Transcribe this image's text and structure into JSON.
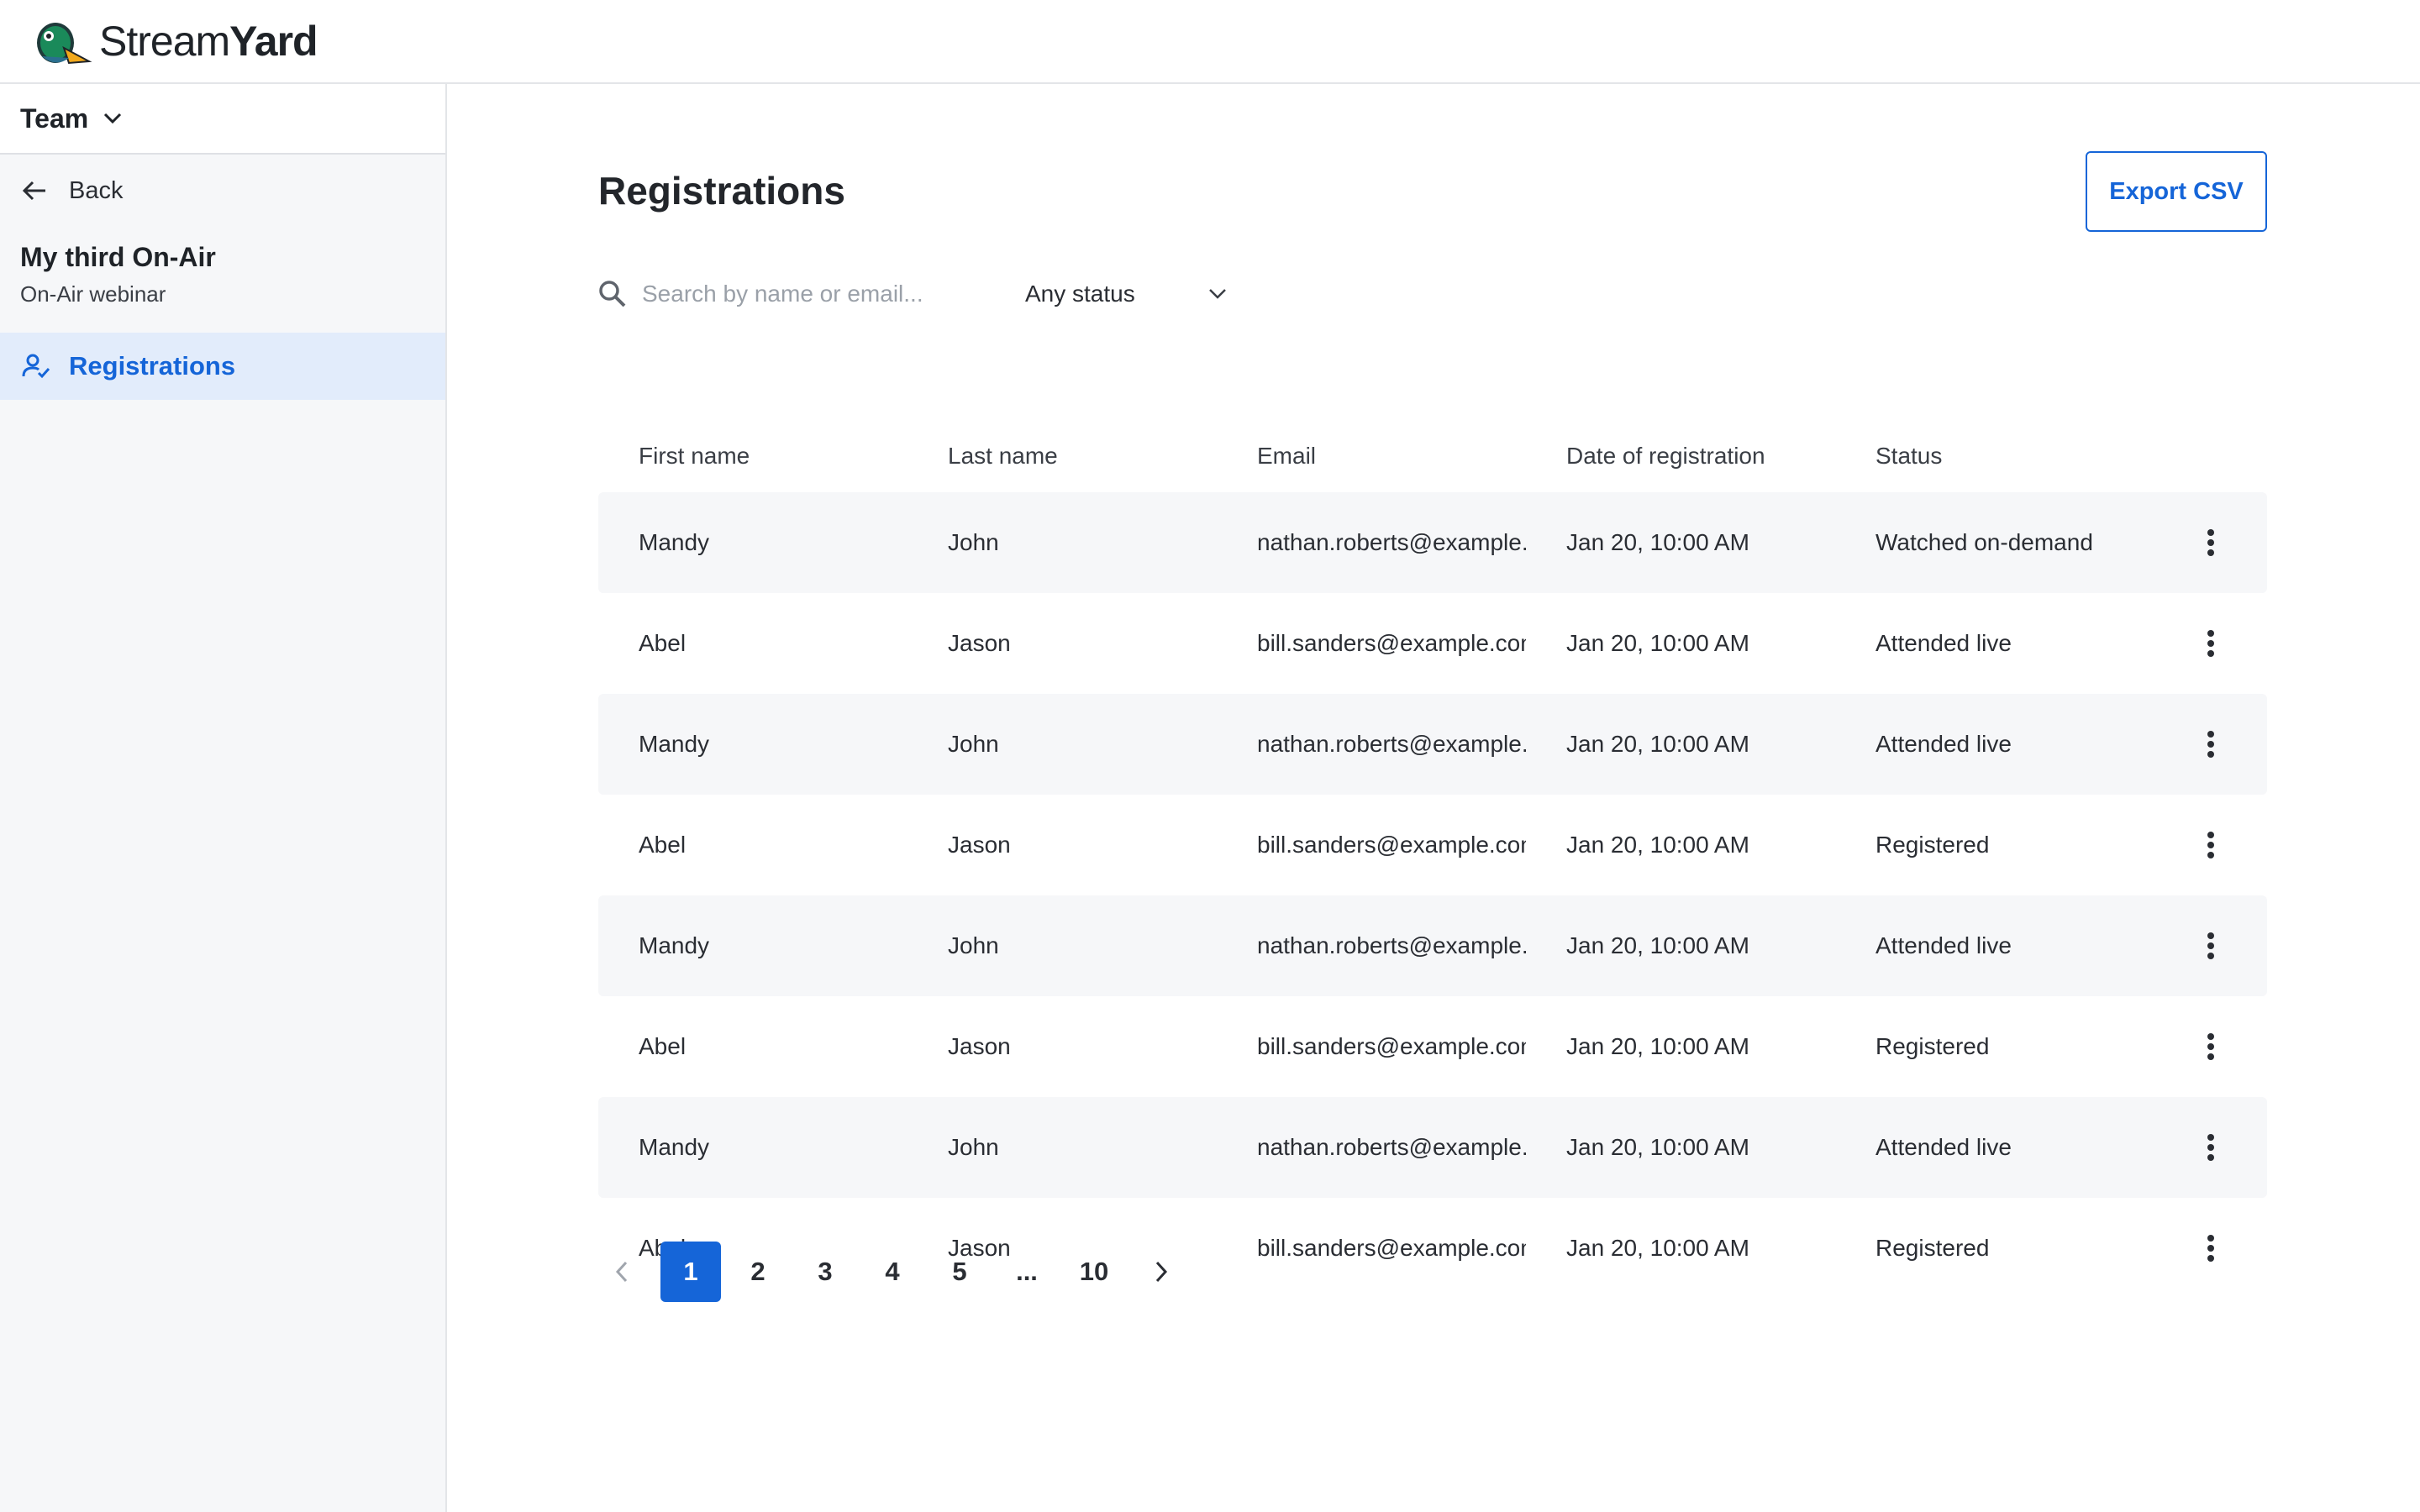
{
  "app": {
    "name_light": "Stream",
    "name_bold": "Yard"
  },
  "sidebar": {
    "team_label": "Team",
    "back_label": "Back",
    "event_title": "My third On-Air",
    "event_subtitle": "On-Air webinar",
    "nav": [
      {
        "label": "Registrations",
        "icon": "person-check-icon",
        "active": true
      }
    ]
  },
  "main": {
    "title": "Registrations",
    "export_label": "Export CSV",
    "search": {
      "placeholder": "Search by name or email...",
      "value": ""
    },
    "status_filter": {
      "value": "Any status"
    },
    "table": {
      "columns": [
        "First name",
        "Last name",
        "Email",
        "Date of registration",
        "Status"
      ],
      "rows": [
        {
          "first": "Mandy",
          "last": "John",
          "email": "nathan.roberts@example.com",
          "date": "Jan 20, 10:00 AM",
          "status": "Watched on-demand"
        },
        {
          "first": "Abel",
          "last": "Jason",
          "email": "bill.sanders@example.com",
          "date": "Jan 20, 10:00 AM",
          "status": "Attended live"
        },
        {
          "first": "Mandy",
          "last": "John",
          "email": "nathan.roberts@example.com",
          "date": "Jan 20, 10:00 AM",
          "status": "Attended live"
        },
        {
          "first": "Abel",
          "last": "Jason",
          "email": "bill.sanders@example.com",
          "date": "Jan 20, 10:00 AM",
          "status": "Registered"
        },
        {
          "first": "Mandy",
          "last": "John",
          "email": "nathan.roberts@example.com",
          "date": "Jan 20, 10:00 AM",
          "status": "Attended live"
        },
        {
          "first": "Abel",
          "last": "Jason",
          "email": "bill.sanders@example.com",
          "date": "Jan 20, 10:00 AM",
          "status": "Registered"
        },
        {
          "first": "Mandy",
          "last": "John",
          "email": "nathan.roberts@example.com",
          "date": "Jan 20, 10:00 AM",
          "status": "Attended live"
        },
        {
          "first": "Abel",
          "last": "Jason",
          "email": "bill.sanders@example.com",
          "date": "Jan 20, 10:00 AM",
          "status": "Registered"
        }
      ]
    },
    "pagination": {
      "pages": [
        "1",
        "2",
        "3",
        "4",
        "5",
        "...",
        "10"
      ],
      "current": "1"
    }
  },
  "colors": {
    "accent": "#1565d8",
    "active_nav_bg": "#e2ecfb",
    "alt_row_bg": "#f6f7f9"
  }
}
